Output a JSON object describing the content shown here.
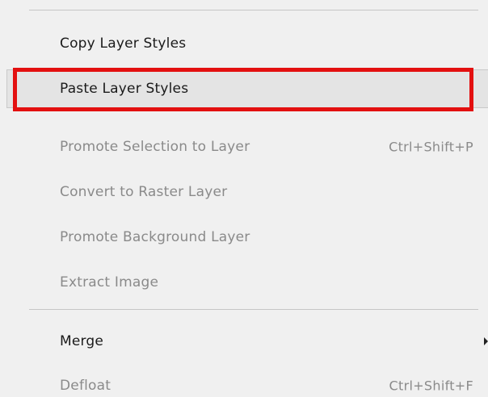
{
  "menu": {
    "items": [
      {
        "label": "Copy Layer Styles",
        "shortcut": "",
        "enabled": true
      },
      {
        "label": "Paste Layer Styles",
        "shortcut": "",
        "enabled": true
      },
      {
        "label": "Promote Selection to Layer",
        "shortcut": "Ctrl+Shift+P",
        "enabled": false
      },
      {
        "label": "Convert to Raster Layer",
        "shortcut": "",
        "enabled": false
      },
      {
        "label": "Promote Background Layer",
        "shortcut": "",
        "enabled": false
      },
      {
        "label": "Extract Image",
        "shortcut": "",
        "enabled": false
      },
      {
        "label": "Merge",
        "shortcut": "",
        "enabled": true,
        "submenu": true
      },
      {
        "label": "Defloat",
        "shortcut": "Ctrl+Shift+F",
        "enabled": false
      }
    ]
  },
  "colors": {
    "highlight_border": "#e31010",
    "menu_background": "#f0f0f0",
    "disabled_text": "#8a8a8a"
  },
  "icons": {
    "submenu_arrow": "chevron-right-icon"
  }
}
